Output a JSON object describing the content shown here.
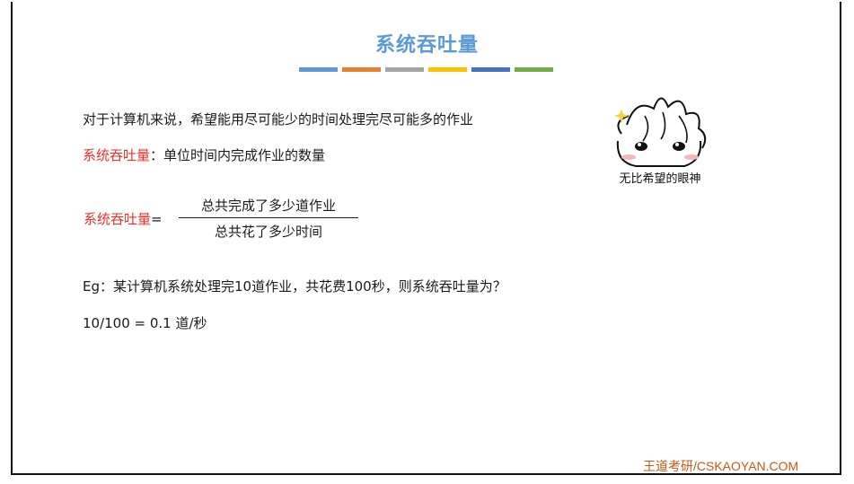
{
  "slide": {
    "title": "系统吞吐量",
    "title_bar_colors": [
      "#5b9bd5",
      "#ed7d31",
      "#a5a5a5",
      "#ffc000",
      "#4472c4",
      "#70ad47"
    ],
    "line1": "对于计算机来说，希望能用尽可能少的时间处理完尽可能多的作业",
    "definition_term": "系统吞吐量",
    "definition_text": "：单位时间内完成作业的数量",
    "formula": {
      "label": "系统吞吐量",
      "equals": "=",
      "numerator": "总共完成了多少道作业",
      "denominator": "总共花了多少时间"
    },
    "example": "Eg：某计算机系统处理完10道作业，共花费100秒，则系统吞吐量为？",
    "answer": "10/100 = 0.1 道/秒",
    "meme_caption": "无比希望的眼神",
    "footer": "王道考研/CSKAOYAN.COM"
  }
}
